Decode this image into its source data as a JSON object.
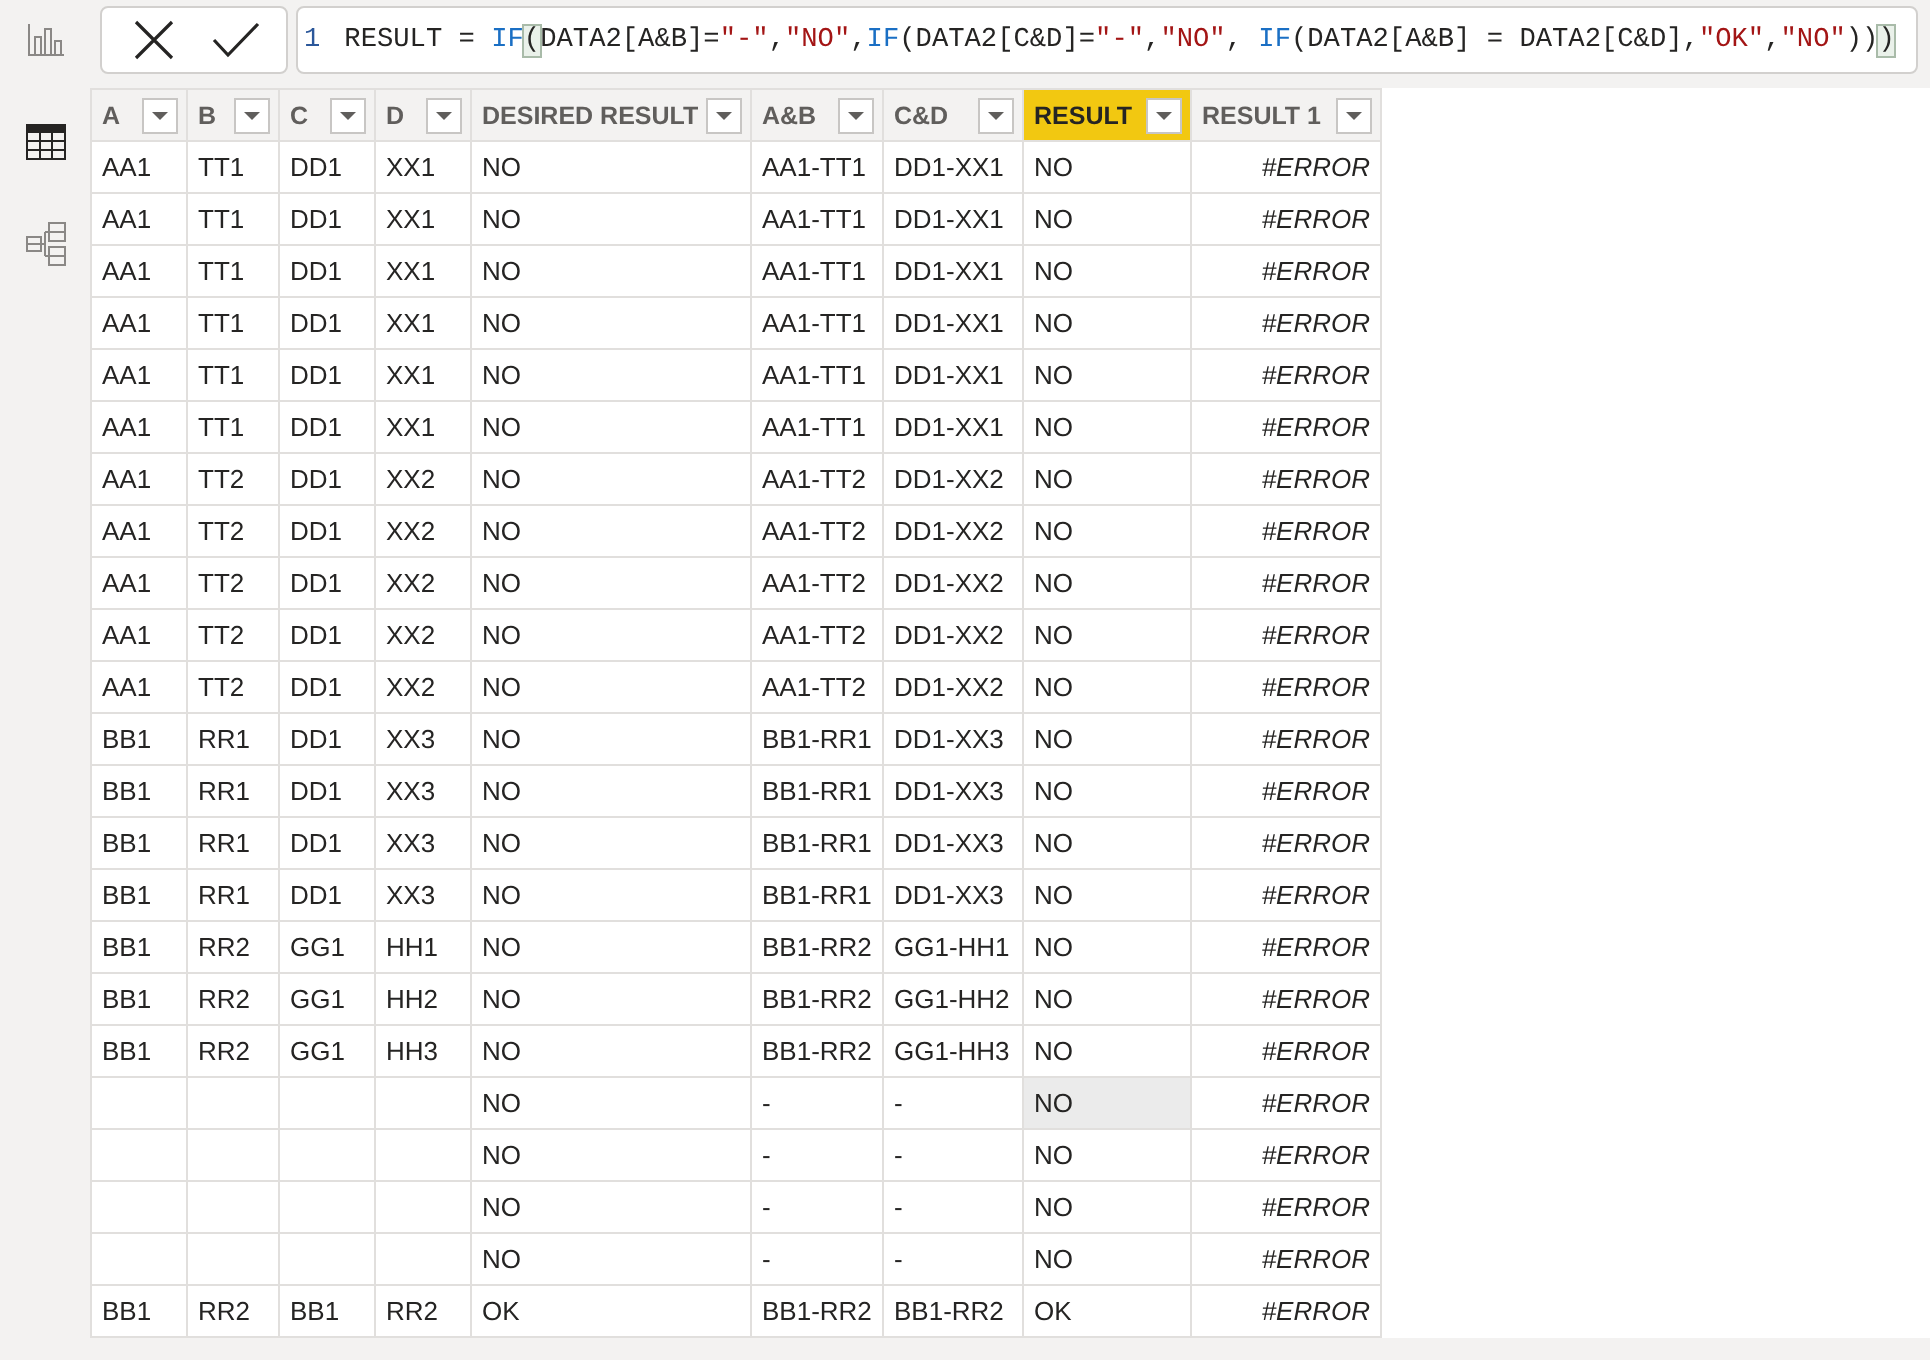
{
  "sidebar": {
    "items": [
      {
        "kind": "report",
        "selected": false
      },
      {
        "kind": "table",
        "selected": true
      },
      {
        "kind": "model",
        "selected": false
      }
    ]
  },
  "formula_bar": {
    "line_number": "1",
    "tokens": [
      {
        "kind": "text",
        "text": "RESULT = "
      },
      {
        "kind": "keyword",
        "text": "IF"
      },
      {
        "kind": "bracket",
        "text": "("
      },
      {
        "kind": "text",
        "text": "DATA2[A&B]="
      },
      {
        "kind": "string",
        "text": "\"-\""
      },
      {
        "kind": "text",
        "text": ","
      },
      {
        "kind": "string",
        "text": "\"NO\""
      },
      {
        "kind": "text",
        "text": ","
      },
      {
        "kind": "keyword",
        "text": "IF"
      },
      {
        "kind": "text",
        "text": "(DATA2[C&D]="
      },
      {
        "kind": "string",
        "text": "\"-\""
      },
      {
        "kind": "text",
        "text": ","
      },
      {
        "kind": "string",
        "text": "\"NO\""
      },
      {
        "kind": "text",
        "text": ", "
      },
      {
        "kind": "keyword",
        "text": "IF"
      },
      {
        "kind": "text",
        "text": "(DATA2[A&B] = DATA2[C&D],"
      },
      {
        "kind": "string",
        "text": "\"OK\""
      },
      {
        "kind": "text",
        "text": ","
      },
      {
        "kind": "string",
        "text": "\"NO\""
      },
      {
        "kind": "text",
        "text": "))"
      },
      {
        "kind": "bracket",
        "text": ")"
      }
    ]
  },
  "table": {
    "columns": [
      {
        "label": "A",
        "kind": "text",
        "selected": false
      },
      {
        "label": "B",
        "kind": "text",
        "selected": false
      },
      {
        "label": "C",
        "kind": "text",
        "selected": false
      },
      {
        "label": "D",
        "kind": "text",
        "selected": false
      },
      {
        "label": "DESIRED RESULT",
        "kind": "text",
        "selected": false
      },
      {
        "label": "A&B",
        "kind": "text",
        "selected": false
      },
      {
        "label": "C&D",
        "kind": "text",
        "selected": false
      },
      {
        "label": "RESULT",
        "kind": "text",
        "selected": true
      },
      {
        "label": "RESULT 1",
        "kind": "error",
        "selected": false
      }
    ],
    "rows": [
      {
        "cells": [
          {
            "text": "AA1",
            "selected": false
          },
          {
            "text": "TT1",
            "selected": false
          },
          {
            "text": "DD1",
            "selected": false
          },
          {
            "text": "XX1",
            "selected": false
          },
          {
            "text": "NO",
            "selected": false
          },
          {
            "text": "AA1-TT1",
            "selected": false
          },
          {
            "text": "DD1-XX1",
            "selected": false
          },
          {
            "text": "NO",
            "selected": false
          },
          {
            "text": "#ERROR",
            "selected": false
          }
        ]
      },
      {
        "cells": [
          {
            "text": "AA1",
            "selected": false
          },
          {
            "text": "TT1",
            "selected": false
          },
          {
            "text": "DD1",
            "selected": false
          },
          {
            "text": "XX1",
            "selected": false
          },
          {
            "text": "NO",
            "selected": false
          },
          {
            "text": "AA1-TT1",
            "selected": false
          },
          {
            "text": "DD1-XX1",
            "selected": false
          },
          {
            "text": "NO",
            "selected": false
          },
          {
            "text": "#ERROR",
            "selected": false
          }
        ]
      },
      {
        "cells": [
          {
            "text": "AA1",
            "selected": false
          },
          {
            "text": "TT1",
            "selected": false
          },
          {
            "text": "DD1",
            "selected": false
          },
          {
            "text": "XX1",
            "selected": false
          },
          {
            "text": "NO",
            "selected": false
          },
          {
            "text": "AA1-TT1",
            "selected": false
          },
          {
            "text": "DD1-XX1",
            "selected": false
          },
          {
            "text": "NO",
            "selected": false
          },
          {
            "text": "#ERROR",
            "selected": false
          }
        ]
      },
      {
        "cells": [
          {
            "text": "AA1",
            "selected": false
          },
          {
            "text": "TT1",
            "selected": false
          },
          {
            "text": "DD1",
            "selected": false
          },
          {
            "text": "XX1",
            "selected": false
          },
          {
            "text": "NO",
            "selected": false
          },
          {
            "text": "AA1-TT1",
            "selected": false
          },
          {
            "text": "DD1-XX1",
            "selected": false
          },
          {
            "text": "NO",
            "selected": false
          },
          {
            "text": "#ERROR",
            "selected": false
          }
        ]
      },
      {
        "cells": [
          {
            "text": "AA1",
            "selected": false
          },
          {
            "text": "TT1",
            "selected": false
          },
          {
            "text": "DD1",
            "selected": false
          },
          {
            "text": "XX1",
            "selected": false
          },
          {
            "text": "NO",
            "selected": false
          },
          {
            "text": "AA1-TT1",
            "selected": false
          },
          {
            "text": "DD1-XX1",
            "selected": false
          },
          {
            "text": "NO",
            "selected": false
          },
          {
            "text": "#ERROR",
            "selected": false
          }
        ]
      },
      {
        "cells": [
          {
            "text": "AA1",
            "selected": false
          },
          {
            "text": "TT1",
            "selected": false
          },
          {
            "text": "DD1",
            "selected": false
          },
          {
            "text": "XX1",
            "selected": false
          },
          {
            "text": "NO",
            "selected": false
          },
          {
            "text": "AA1-TT1",
            "selected": false
          },
          {
            "text": "DD1-XX1",
            "selected": false
          },
          {
            "text": "NO",
            "selected": false
          },
          {
            "text": "#ERROR",
            "selected": false
          }
        ]
      },
      {
        "cells": [
          {
            "text": "AA1",
            "selected": false
          },
          {
            "text": "TT2",
            "selected": false
          },
          {
            "text": "DD1",
            "selected": false
          },
          {
            "text": "XX2",
            "selected": false
          },
          {
            "text": "NO",
            "selected": false
          },
          {
            "text": "AA1-TT2",
            "selected": false
          },
          {
            "text": "DD1-XX2",
            "selected": false
          },
          {
            "text": "NO",
            "selected": false
          },
          {
            "text": "#ERROR",
            "selected": false
          }
        ]
      },
      {
        "cells": [
          {
            "text": "AA1",
            "selected": false
          },
          {
            "text": "TT2",
            "selected": false
          },
          {
            "text": "DD1",
            "selected": false
          },
          {
            "text": "XX2",
            "selected": false
          },
          {
            "text": "NO",
            "selected": false
          },
          {
            "text": "AA1-TT2",
            "selected": false
          },
          {
            "text": "DD1-XX2",
            "selected": false
          },
          {
            "text": "NO",
            "selected": false
          },
          {
            "text": "#ERROR",
            "selected": false
          }
        ]
      },
      {
        "cells": [
          {
            "text": "AA1",
            "selected": false
          },
          {
            "text": "TT2",
            "selected": false
          },
          {
            "text": "DD1",
            "selected": false
          },
          {
            "text": "XX2",
            "selected": false
          },
          {
            "text": "NO",
            "selected": false
          },
          {
            "text": "AA1-TT2",
            "selected": false
          },
          {
            "text": "DD1-XX2",
            "selected": false
          },
          {
            "text": "NO",
            "selected": false
          },
          {
            "text": "#ERROR",
            "selected": false
          }
        ]
      },
      {
        "cells": [
          {
            "text": "AA1",
            "selected": false
          },
          {
            "text": "TT2",
            "selected": false
          },
          {
            "text": "DD1",
            "selected": false
          },
          {
            "text": "XX2",
            "selected": false
          },
          {
            "text": "NO",
            "selected": false
          },
          {
            "text": "AA1-TT2",
            "selected": false
          },
          {
            "text": "DD1-XX2",
            "selected": false
          },
          {
            "text": "NO",
            "selected": false
          },
          {
            "text": "#ERROR",
            "selected": false
          }
        ]
      },
      {
        "cells": [
          {
            "text": "AA1",
            "selected": false
          },
          {
            "text": "TT2",
            "selected": false
          },
          {
            "text": "DD1",
            "selected": false
          },
          {
            "text": "XX2",
            "selected": false
          },
          {
            "text": "NO",
            "selected": false
          },
          {
            "text": "AA1-TT2",
            "selected": false
          },
          {
            "text": "DD1-XX2",
            "selected": false
          },
          {
            "text": "NO",
            "selected": false
          },
          {
            "text": "#ERROR",
            "selected": false
          }
        ]
      },
      {
        "cells": [
          {
            "text": "BB1",
            "selected": false
          },
          {
            "text": "RR1",
            "selected": false
          },
          {
            "text": "DD1",
            "selected": false
          },
          {
            "text": "XX3",
            "selected": false
          },
          {
            "text": "NO",
            "selected": false
          },
          {
            "text": "BB1-RR1",
            "selected": false
          },
          {
            "text": "DD1-XX3",
            "selected": false
          },
          {
            "text": "NO",
            "selected": false
          },
          {
            "text": "#ERROR",
            "selected": false
          }
        ]
      },
      {
        "cells": [
          {
            "text": "BB1",
            "selected": false
          },
          {
            "text": "RR1",
            "selected": false
          },
          {
            "text": "DD1",
            "selected": false
          },
          {
            "text": "XX3",
            "selected": false
          },
          {
            "text": "NO",
            "selected": false
          },
          {
            "text": "BB1-RR1",
            "selected": false
          },
          {
            "text": "DD1-XX3",
            "selected": false
          },
          {
            "text": "NO",
            "selected": false
          },
          {
            "text": "#ERROR",
            "selected": false
          }
        ]
      },
      {
        "cells": [
          {
            "text": "BB1",
            "selected": false
          },
          {
            "text": "RR1",
            "selected": false
          },
          {
            "text": "DD1",
            "selected": false
          },
          {
            "text": "XX3",
            "selected": false
          },
          {
            "text": "NO",
            "selected": false
          },
          {
            "text": "BB1-RR1",
            "selected": false
          },
          {
            "text": "DD1-XX3",
            "selected": false
          },
          {
            "text": "NO",
            "selected": false
          },
          {
            "text": "#ERROR",
            "selected": false
          }
        ]
      },
      {
        "cells": [
          {
            "text": "BB1",
            "selected": false
          },
          {
            "text": "RR1",
            "selected": false
          },
          {
            "text": "DD1",
            "selected": false
          },
          {
            "text": "XX3",
            "selected": false
          },
          {
            "text": "NO",
            "selected": false
          },
          {
            "text": "BB1-RR1",
            "selected": false
          },
          {
            "text": "DD1-XX3",
            "selected": false
          },
          {
            "text": "NO",
            "selected": false
          },
          {
            "text": "#ERROR",
            "selected": false
          }
        ]
      },
      {
        "cells": [
          {
            "text": "BB1",
            "selected": false
          },
          {
            "text": "RR2",
            "selected": false
          },
          {
            "text": "GG1",
            "selected": false
          },
          {
            "text": "HH1",
            "selected": false
          },
          {
            "text": "NO",
            "selected": false
          },
          {
            "text": "BB1-RR2",
            "selected": false
          },
          {
            "text": "GG1-HH1",
            "selected": false
          },
          {
            "text": "NO",
            "selected": false
          },
          {
            "text": "#ERROR",
            "selected": false
          }
        ]
      },
      {
        "cells": [
          {
            "text": "BB1",
            "selected": false
          },
          {
            "text": "RR2",
            "selected": false
          },
          {
            "text": "GG1",
            "selected": false
          },
          {
            "text": "HH2",
            "selected": false
          },
          {
            "text": "NO",
            "selected": false
          },
          {
            "text": "BB1-RR2",
            "selected": false
          },
          {
            "text": "GG1-HH2",
            "selected": false
          },
          {
            "text": "NO",
            "selected": false
          },
          {
            "text": "#ERROR",
            "selected": false
          }
        ]
      },
      {
        "cells": [
          {
            "text": "BB1",
            "selected": false
          },
          {
            "text": "RR2",
            "selected": false
          },
          {
            "text": "GG1",
            "selected": false
          },
          {
            "text": "HH3",
            "selected": false
          },
          {
            "text": "NO",
            "selected": false
          },
          {
            "text": "BB1-RR2",
            "selected": false
          },
          {
            "text": "GG1-HH3",
            "selected": false
          },
          {
            "text": "NO",
            "selected": false
          },
          {
            "text": "#ERROR",
            "selected": false
          }
        ]
      },
      {
        "cells": [
          {
            "selected": false
          },
          {
            "selected": false
          },
          {
            "selected": false
          },
          {
            "selected": false
          },
          {
            "text": "NO",
            "selected": false
          },
          {
            "text": "-",
            "selected": false
          },
          {
            "text": "-",
            "selected": false
          },
          {
            "text": "NO",
            "selected": true
          },
          {
            "text": "#ERROR",
            "selected": false
          }
        ]
      },
      {
        "cells": [
          {
            "selected": false
          },
          {
            "selected": false
          },
          {
            "selected": false
          },
          {
            "selected": false
          },
          {
            "text": "NO",
            "selected": false
          },
          {
            "text": "-",
            "selected": false
          },
          {
            "text": "-",
            "selected": false
          },
          {
            "text": "NO",
            "selected": false
          },
          {
            "text": "#ERROR",
            "selected": false
          }
        ]
      },
      {
        "cells": [
          {
            "selected": false
          },
          {
            "selected": false
          },
          {
            "selected": false
          },
          {
            "selected": false
          },
          {
            "text": "NO",
            "selected": false
          },
          {
            "text": "-",
            "selected": false
          },
          {
            "text": "-",
            "selected": false
          },
          {
            "text": "NO",
            "selected": false
          },
          {
            "text": "#ERROR",
            "selected": false
          }
        ]
      },
      {
        "cells": [
          {
            "selected": false
          },
          {
            "selected": false
          },
          {
            "selected": false
          },
          {
            "selected": false
          },
          {
            "text": "NO",
            "selected": false
          },
          {
            "text": "-",
            "selected": false
          },
          {
            "text": "-",
            "selected": false
          },
          {
            "text": "NO",
            "selected": false
          },
          {
            "text": "#ERROR",
            "selected": false
          }
        ]
      },
      {
        "cells": [
          {
            "text": "BB1",
            "selected": false
          },
          {
            "text": "RR2",
            "selected": false
          },
          {
            "text": "BB1",
            "selected": false
          },
          {
            "text": "RR2",
            "selected": false
          },
          {
            "text": "OK",
            "selected": false
          },
          {
            "text": "BB1-RR2",
            "selected": false
          },
          {
            "text": "BB1-RR2",
            "selected": false
          },
          {
            "text": "OK",
            "selected": false
          },
          {
            "text": "#ERROR",
            "selected": false
          }
        ]
      }
    ]
  }
}
